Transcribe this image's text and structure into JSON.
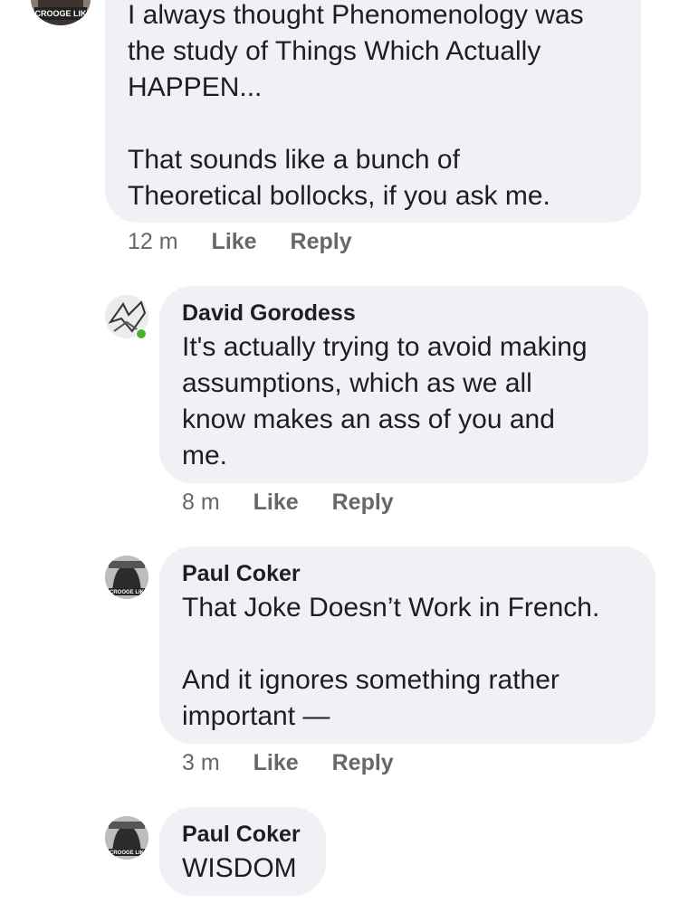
{
  "comments": [
    {
      "author": "",
      "avatar_caption": "SCROOGE LIKE",
      "text": "I always thought Phenomenology was\nthe study of Things Which Actually\nHAPPEN...\n\nThat sounds like a bunch of\nTheoretical bollocks, if you ask me.",
      "time": "12 m",
      "like_label": "Like",
      "reply_label": "Reply"
    },
    {
      "author": "David Gorodess",
      "online": true,
      "text": "It's actually trying to avoid making\nassumptions,  which as we all\nknow makes an ass of you and\nme.",
      "time": "8 m",
      "like_label": "Like",
      "reply_label": "Reply"
    },
    {
      "author": "Paul Coker",
      "avatar_caption": "SCROOGE LIKE",
      "text": "That Joke Doesn’t Work in French.\n\nAnd it ignores something rather\nimportant —",
      "time": "3 m",
      "like_label": "Like",
      "reply_label": "Reply"
    },
    {
      "author": "Paul Coker",
      "avatar_caption": "SCROOGE LIKE",
      "text": "WISDOM"
    }
  ],
  "colors": {
    "bubble": "#f0f1f4",
    "meta_text": "#65676b",
    "online": "#42b72a"
  },
  "icons": [
    "profile-avatar",
    "online-status-dot"
  ]
}
